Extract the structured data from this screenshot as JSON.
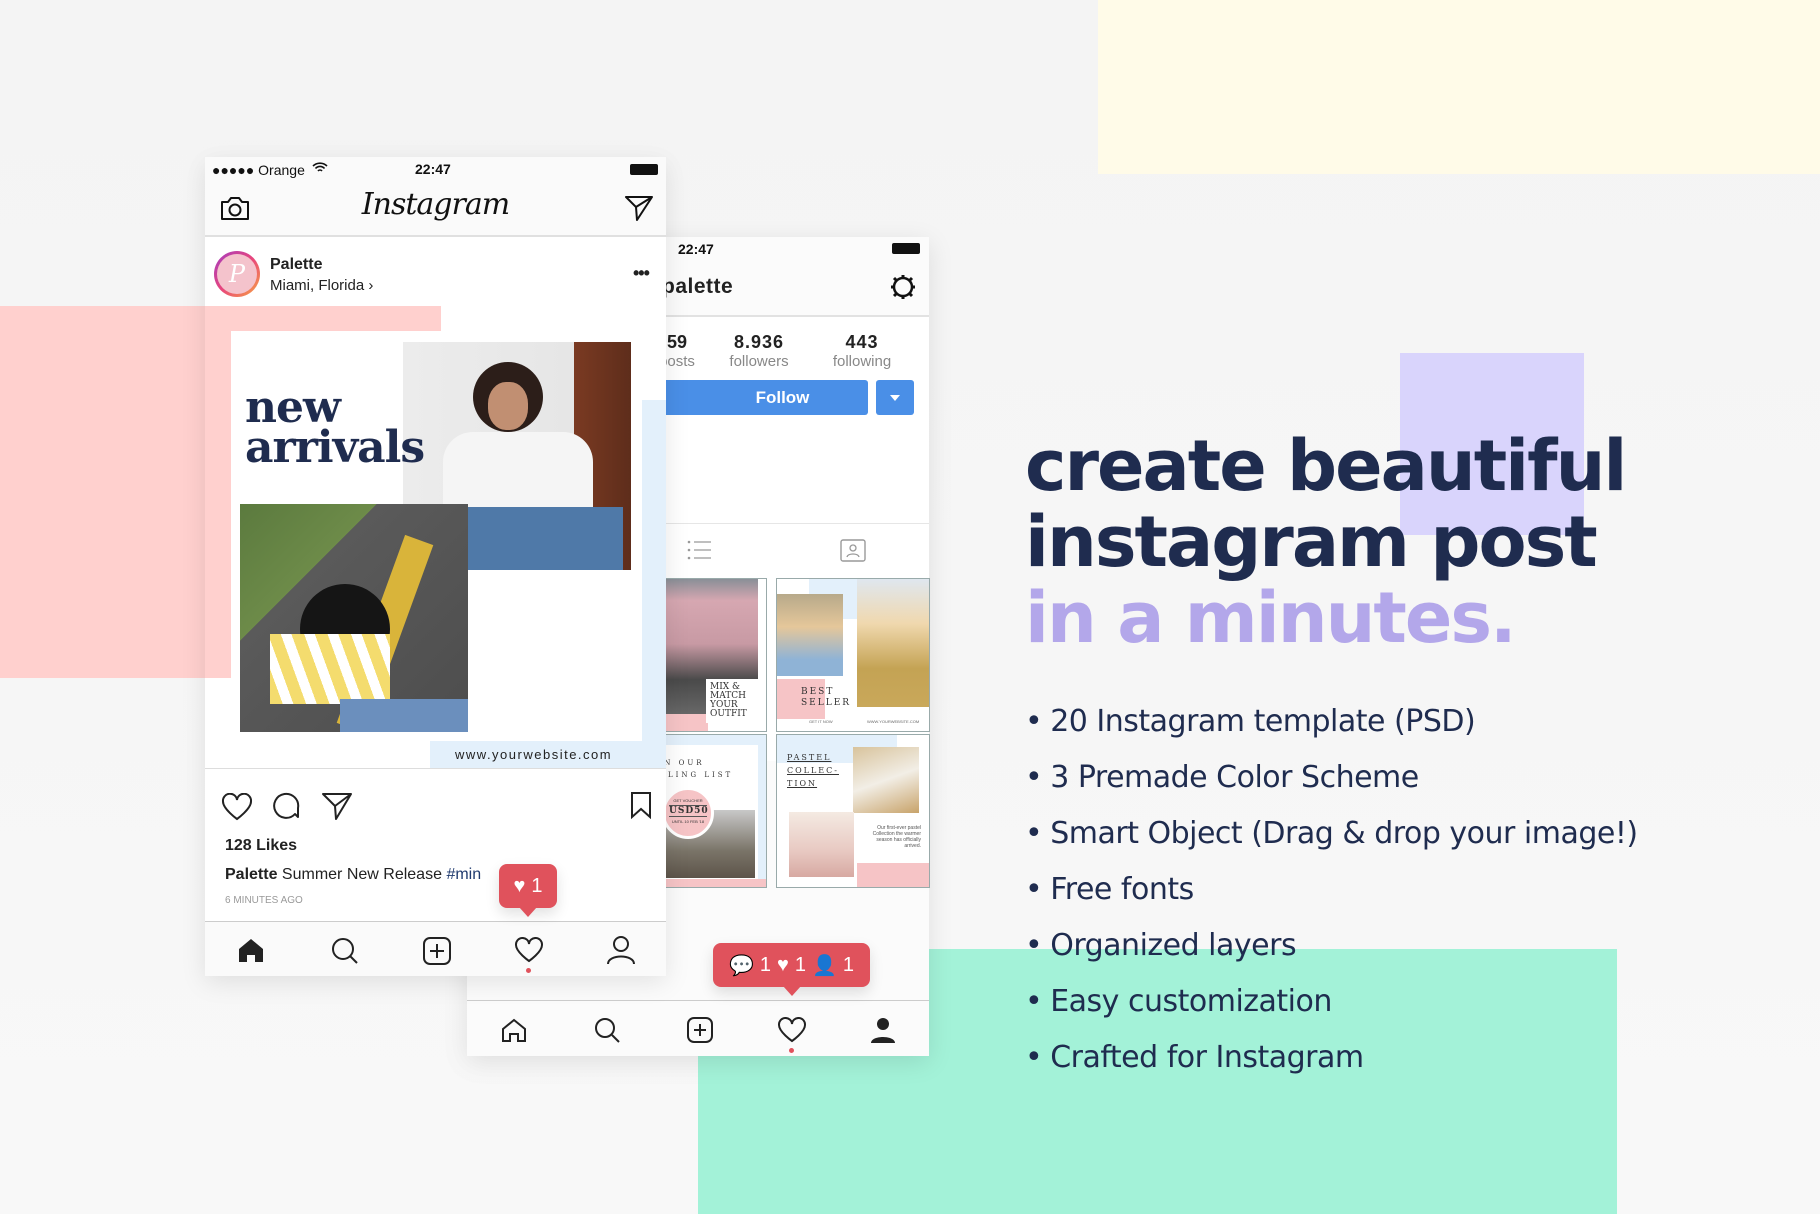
{
  "colors": {
    "yellow_block": "#fffbe8",
    "pink_block": "#ffd0ce",
    "green_block": "#a3f2d8",
    "purple_block": "#d9d4fc",
    "navy": "#1f2c4f",
    "lavender": "#b3a7ea",
    "follow_blue": "#4a8fe7",
    "badge_red": "#e0525c"
  },
  "feed_phone": {
    "status": {
      "carrier": "●●●●● Orange",
      "time": "22:47"
    },
    "logo": "Instagram",
    "post": {
      "username": "Palette",
      "location": "Miami, Florida ›",
      "image_title_line1": "new",
      "image_title_line2": "arrivals",
      "website": "www.yourwebsite.com",
      "likes": "128 Likes",
      "caption_user": "Palette",
      "caption_text": "Summer New Release",
      "caption_tag": "#min",
      "time": "6 MINUTES AGO"
    },
    "notification": {
      "likes": "1"
    },
    "nav": [
      "home-icon",
      "search-icon",
      "add-icon",
      "heart-icon",
      "profile-icon"
    ]
  },
  "profile_phone": {
    "status": {
      "time": "22:47"
    },
    "username": "palette",
    "stats": [
      {
        "value": "59",
        "label": "posts"
      },
      {
        "value": "8.936",
        "label": "followers"
      },
      {
        "value": "443",
        "label": "following"
      }
    ],
    "follow_label": "Follow",
    "grid": [
      {
        "text": "MIX & MATCH YOUR OUTFIT"
      },
      {
        "text": "BEST SELLER",
        "footer_left": "GET IT NOW",
        "footer_right": "WWW.YOURWEBSITE.COM"
      },
      {
        "text": "JOIN OUR MAILING LIST",
        "voucher_top": "GET VOUCHER",
        "voucher": "USD50",
        "voucher_bottom": "UNTIL 10 FEB '18"
      },
      {
        "text": "PASTEL COLLEC- TION",
        "body": "Our first-ever pastel Collection the warmer season has officially arrived."
      }
    ],
    "notification": {
      "comments": "1",
      "likes": "1",
      "follows": "1"
    }
  },
  "headline": {
    "line1": "create beautiful",
    "line2": "instagram post",
    "line3": "in a minutes."
  },
  "features": [
    "20 Instagram template (PSD)",
    "3 Premade Color Scheme",
    "Smart Object (Drag & drop your image!)",
    "Free fonts",
    "Organized layers",
    "Easy customization",
    "Crafted for Instagram"
  ]
}
